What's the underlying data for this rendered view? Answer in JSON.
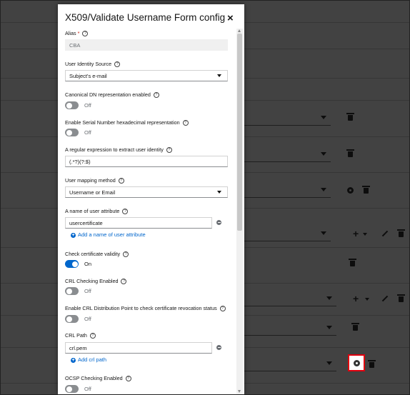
{
  "modal": {
    "title": "X509/Validate Username Form config",
    "close_glyph": "×"
  },
  "fields": {
    "alias_label": "Alias",
    "alias_required": "*",
    "alias_value": "CBA",
    "identity_source_label": "User Identity Source",
    "identity_source_value": "Subject's e-mail",
    "canonical_dn_label": "Canonical DN representation enabled",
    "canonical_dn_state": "Off",
    "serial_hex_label": "Enable Serial Number hexadecimal representation",
    "serial_hex_state": "Off",
    "regex_label": "A regular expression to extract user identity",
    "regex_value": "(.*?)(?:$)",
    "mapping_method_label": "User mapping method",
    "mapping_method_value": "Username or Email",
    "attr_name_label": "A name of user attribute",
    "attr_name_value": "usercertificate",
    "attr_name_add": "Add a name of user attribute",
    "check_validity_label": "Check certificate validity",
    "check_validity_state": "On",
    "crl_enabled_label": "CRL Checking Enabled",
    "crl_enabled_state": "Off",
    "crl_dp_label": "Enable CRL Distribution Point to check certificate revocation status",
    "crl_dp_state": "Off",
    "crl_path_label": "CRL Path",
    "crl_path_value": "crl.pem",
    "crl_path_add": "Add crl path",
    "ocsp_label": "OCSP Checking Enabled",
    "ocsp_state": "Off"
  },
  "help_glyph": "?",
  "add_glyph": "+",
  "icons": {
    "highlighted": "gear-icon",
    "row_actions": [
      "trash-icon",
      "gear-icon",
      "plus-icon",
      "pencil-icon"
    ]
  },
  "colors": {
    "accent": "#0066cc",
    "highlight_border": "#e0000e",
    "required": "#c9190b",
    "toggle_off": "#8a8d90"
  }
}
